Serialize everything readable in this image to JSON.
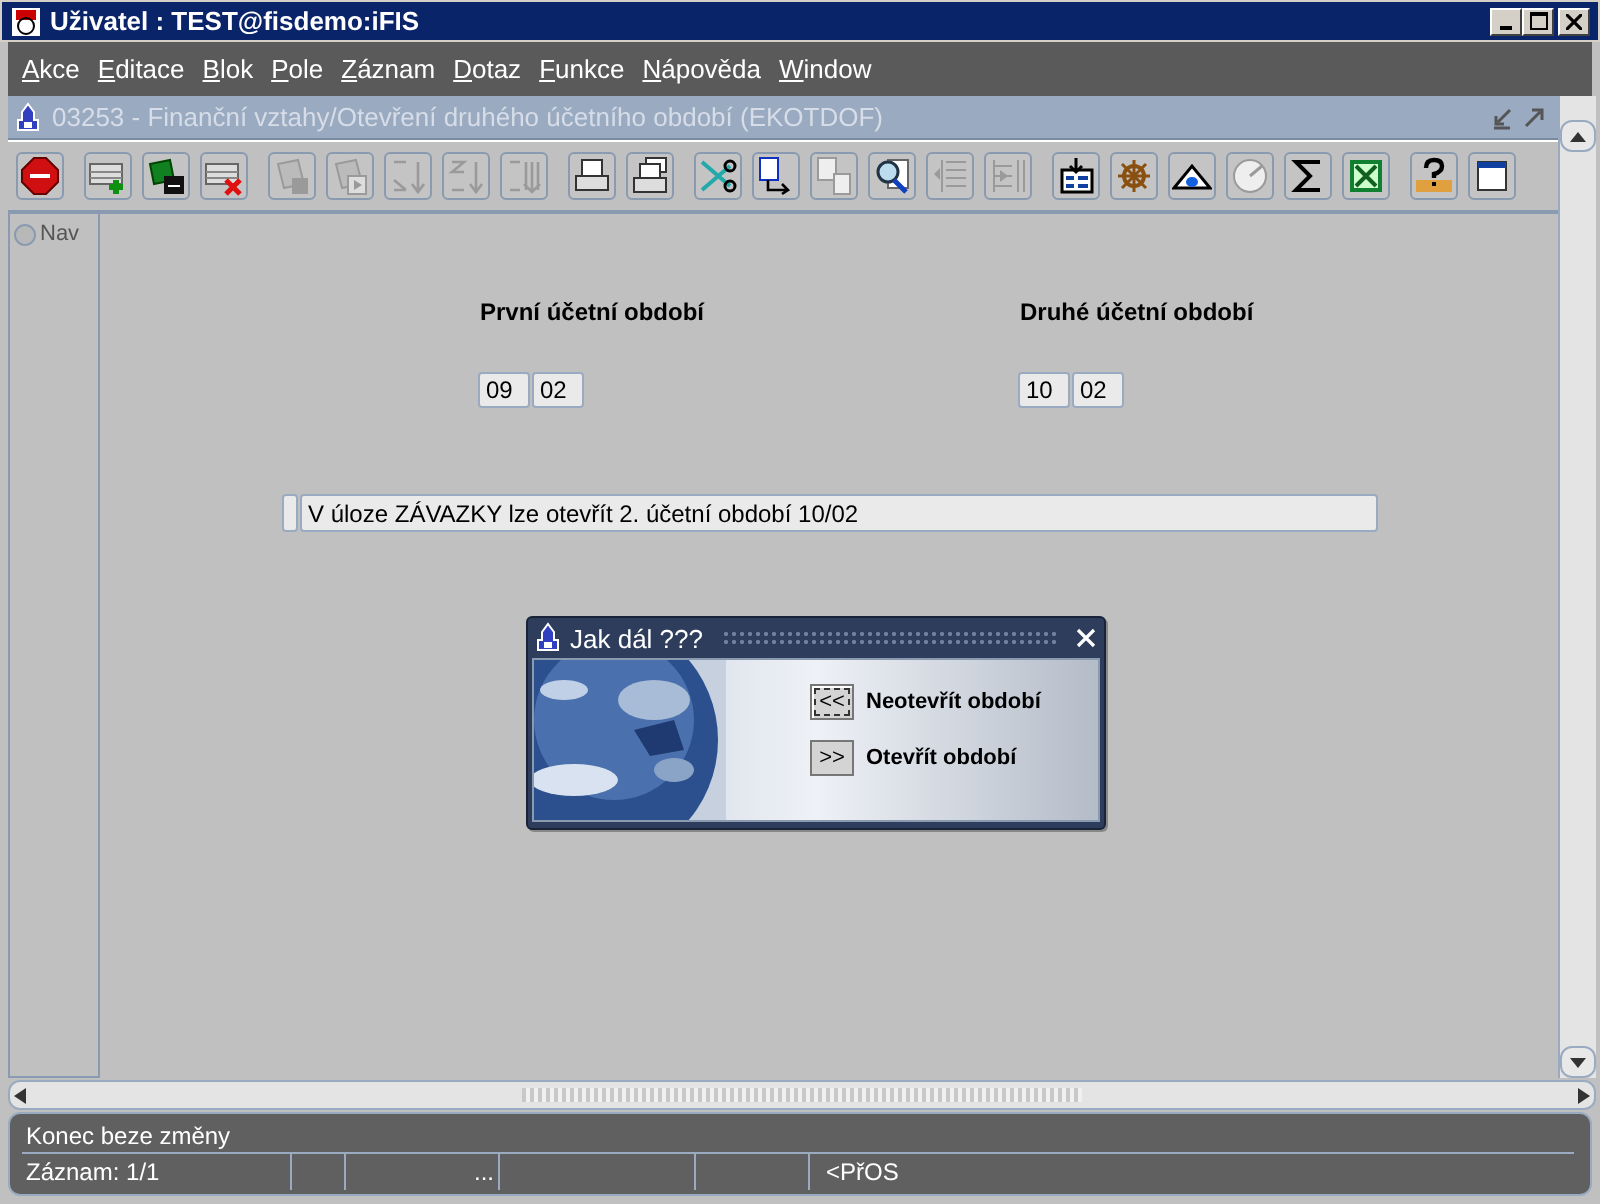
{
  "window": {
    "title": "Uživatel : TEST@fisdemo:iFIS"
  },
  "menu": [
    "Akce",
    "Editace",
    "Blok",
    "Pole",
    "Záznam",
    "Dotaz",
    "Funkce",
    "Nápověda",
    "Window"
  ],
  "form_window": {
    "title": "03253 - Finanční vztahy/Otevření druhého účetního období (EKOTDOF)"
  },
  "toolbar": {
    "groups": [
      [
        {
          "kind": "exit",
          "disabled": false
        }
      ],
      [
        {
          "kind": "add",
          "disabled": false
        },
        {
          "kind": "save",
          "disabled": false
        },
        {
          "kind": "delete",
          "disabled": false
        }
      ],
      [
        {
          "kind": "query",
          "disabled": true
        },
        {
          "kind": "execute",
          "disabled": true
        },
        {
          "kind": "sort_asc",
          "disabled": true
        },
        {
          "kind": "sort_desc",
          "disabled": true
        },
        {
          "kind": "sort",
          "disabled": true
        }
      ],
      [
        {
          "kind": "print",
          "disabled": false
        },
        {
          "kind": "print_multi",
          "disabled": false
        }
      ],
      [
        {
          "kind": "cut",
          "disabled": false
        },
        {
          "kind": "copy",
          "disabled": false
        },
        {
          "kind": "paste",
          "disabled": true
        },
        {
          "kind": "search",
          "disabled": false
        },
        {
          "kind": "outdent",
          "disabled": true
        },
        {
          "kind": "indent",
          "disabled": true
        }
      ],
      [
        {
          "kind": "form",
          "disabled": false
        },
        {
          "kind": "wheel",
          "disabled": false
        },
        {
          "kind": "eye",
          "disabled": false
        },
        {
          "kind": "gauge",
          "disabled": true
        },
        {
          "kind": "sigma",
          "disabled": false
        },
        {
          "kind": "sheet",
          "disabled": false
        }
      ],
      [
        {
          "kind": "help",
          "disabled": false
        },
        {
          "kind": "window",
          "disabled": false
        }
      ]
    ]
  },
  "nav": {
    "label": "Nav",
    "selected": false
  },
  "form": {
    "sections": [
      {
        "heading": "První účetní období",
        "fields": [
          "09",
          "02"
        ]
      },
      {
        "heading": "Druhé účetní období",
        "fields": [
          "10",
          "02"
        ]
      }
    ],
    "message": "V úloze ZÁVAZKY lze otevřít 2. účetní období 10/02"
  },
  "dialog": {
    "title": "Jak dál ???",
    "options": [
      {
        "key": "<<",
        "label": "Neotevřít období",
        "focused": true
      },
      {
        "key": ">>",
        "label": "Otevřít období",
        "focused": false
      }
    ]
  },
  "status": {
    "message": "Konec beze změny",
    "cells": [
      "Záznam: 1/1",
      "",
      "...",
      "",
      "",
      "<PřOS"
    ]
  }
}
